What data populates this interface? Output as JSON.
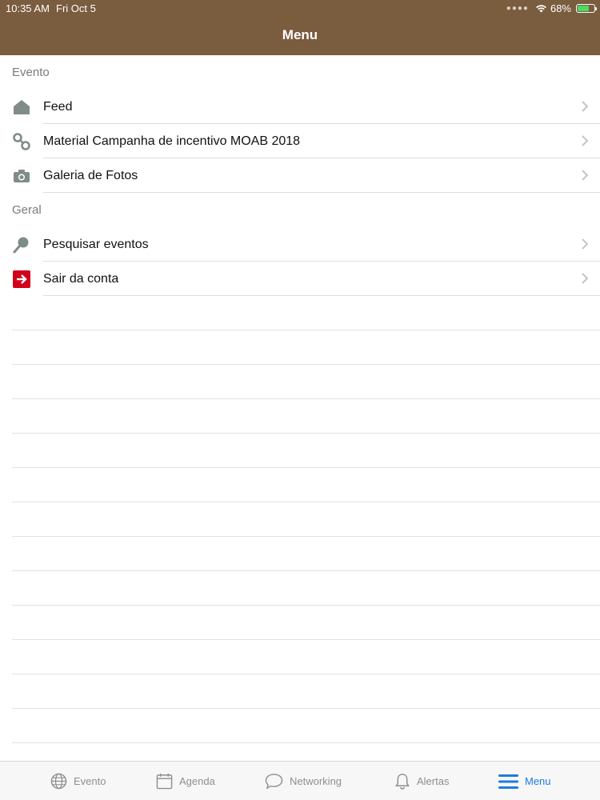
{
  "status_bar": {
    "time": "10:35 AM",
    "date": "Fri Oct 5",
    "battery": "68%",
    "battery_level": 0.68
  },
  "header": {
    "title": "Menu"
  },
  "sections": [
    {
      "title": "Evento",
      "items": [
        {
          "label": "Feed",
          "icon": "home-icon"
        },
        {
          "label": "Material Campanha de incentivo MOAB 2018",
          "icon": "link-icon"
        },
        {
          "label": "Galeria de Fotos",
          "icon": "camera-icon"
        }
      ]
    },
    {
      "title": "Geral",
      "items": [
        {
          "label": "Pesquisar eventos",
          "icon": "search-icon"
        },
        {
          "label": "Sair da conta",
          "icon": "logout-icon"
        }
      ]
    }
  ],
  "tabbar": {
    "tabs": [
      {
        "label": "Evento",
        "icon": "globe-icon",
        "active": false
      },
      {
        "label": "Agenda",
        "icon": "calendar-icon",
        "active": false
      },
      {
        "label": "Networking",
        "icon": "chat-bubble-icon",
        "active": false
      },
      {
        "label": "Alertas",
        "icon": "bell-icon",
        "active": false
      },
      {
        "label": "Menu",
        "icon": "hamburger-menu-icon",
        "active": true
      }
    ]
  },
  "colors": {
    "header_bg": "#7a5c3e",
    "active_tab": "#1f7ae0",
    "logout_icon": "#d0021b",
    "icon_gray": "#7f8c87"
  }
}
